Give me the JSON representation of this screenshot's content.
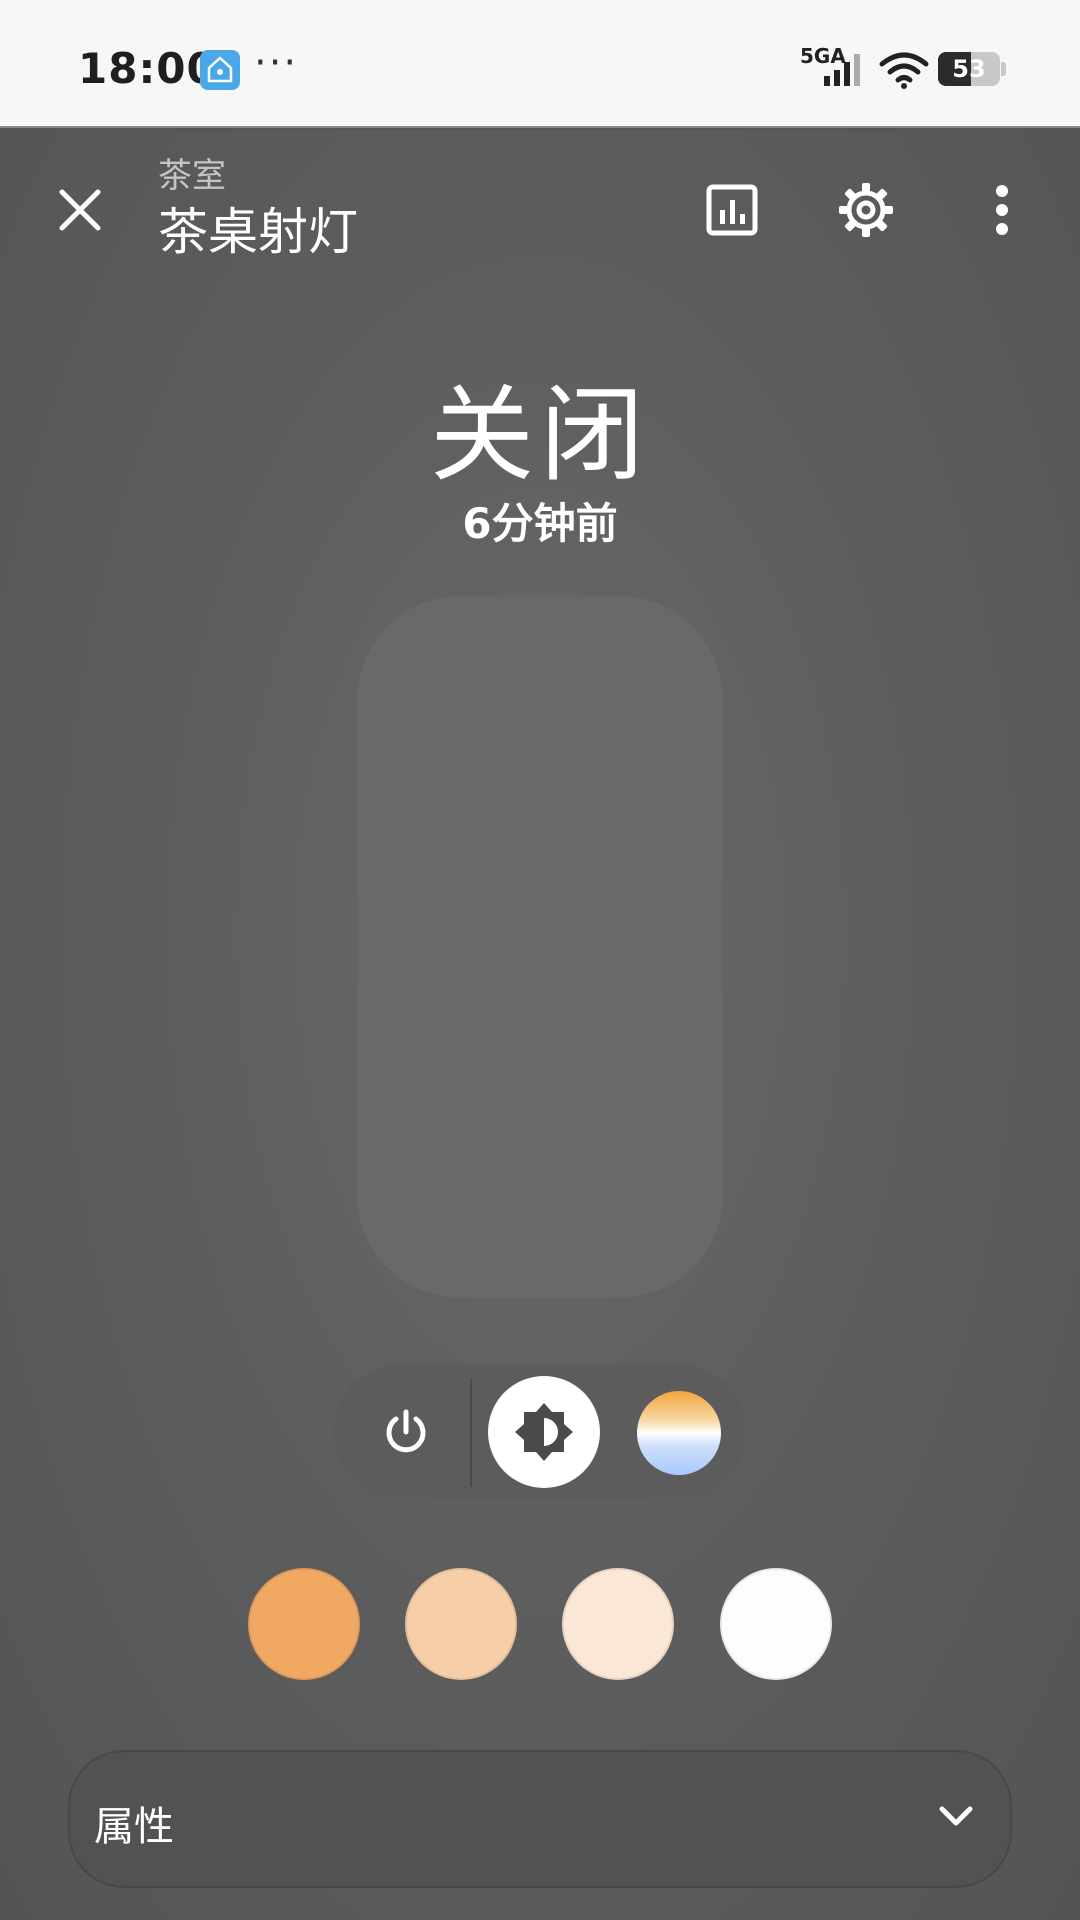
{
  "status_bar": {
    "time": "18:00",
    "more": "···",
    "network": "5GA",
    "battery_percent": 53,
    "battery_text": "53",
    "app_icon_color": "#4aa7e8"
  },
  "header": {
    "room": "茶室",
    "device": "茶桌射灯",
    "icons": [
      "close-icon",
      "history-chart-icon",
      "settings-gear-icon",
      "more-vert-icon"
    ]
  },
  "state": {
    "label": "关闭",
    "last_changed": "6分钟前"
  },
  "modes": {
    "icons": [
      "power-icon",
      "brightness-icon",
      "color-temperature-icon"
    ],
    "selected": "brightness"
  },
  "swatches": {
    "colors": [
      "#f0a862",
      "#f6cfa9",
      "#fbe7d5",
      "#fdfdfb"
    ]
  },
  "attributes": {
    "label": "属性"
  },
  "colors": {
    "background": "#565656",
    "slider_track": "#6a6969",
    "text": "#ffffff"
  }
}
